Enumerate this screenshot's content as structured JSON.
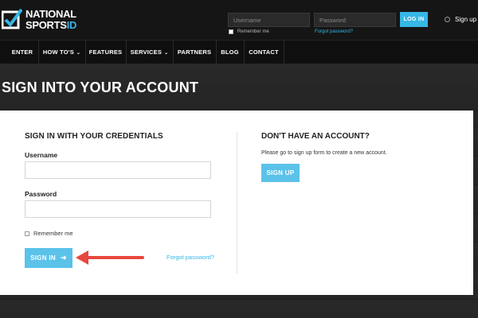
{
  "brand": {
    "line1": "NATIONAL",
    "line2_main": "SPORTS",
    "line2_accent": "ID",
    "accent_color": "#36b7e6"
  },
  "top_login": {
    "username_placeholder": "Username",
    "password_placeholder": "Password",
    "login_label": "LOG IN",
    "remember_label": "Remember me",
    "forgot_label": "Forgot password?",
    "signup_label": "Sign up"
  },
  "nav": {
    "items": [
      {
        "label": "ENTER"
      },
      {
        "label": "HOW TO'S",
        "dropdown": true
      },
      {
        "label": "FEATURES"
      },
      {
        "label": "SERVICES",
        "dropdown": true
      },
      {
        "label": "PARTNERS"
      },
      {
        "label": "BLOG"
      },
      {
        "label": "CONTACT"
      }
    ],
    "chevron": "⌄"
  },
  "hero": {
    "title": "SIGN INTO YOUR ACCOUNT"
  },
  "signin_form": {
    "heading": "SIGN IN WITH YOUR CREDENTIALS",
    "username_label": "Username",
    "password_label": "Password",
    "remember_label": "Remember me",
    "signin_label": "SIGN IN",
    "signin_icon": "signin-arrow-icon",
    "forgot_label": "Forgot password?",
    "button_color": "#5bc2ea"
  },
  "signup_panel": {
    "heading": "DON'T HAVE AN ACCOUNT?",
    "description": "Please go to sign up form to create a new account.",
    "button_label": "SIGN UP"
  },
  "annotation": {
    "arrow_color": "#e8473f"
  }
}
